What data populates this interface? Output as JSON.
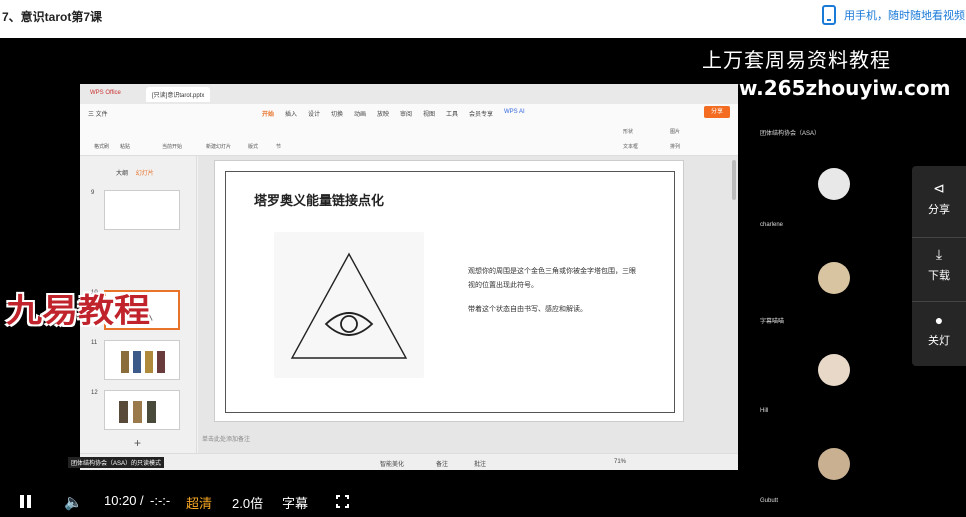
{
  "page": {
    "course_title": "7、意识tarot第7课",
    "phone_link": "用手机，随时随地看视频"
  },
  "watermark": {
    "line1": "上万套周易资料教程",
    "line2": "www.265zhouyiw.com",
    "logo": "九易教程"
  },
  "wps": {
    "tabs": [
      "WPS Office",
      "[只读]意识tarot.pptx"
    ],
    "menu": [
      "三 文件",
      "开始",
      "插入",
      "设计",
      "切换",
      "动画",
      "放映",
      "审阅",
      "视图",
      "工具",
      "会员专享",
      "WPS AI"
    ],
    "share": "分享",
    "ribbon_items": [
      "格式刷",
      "粘贴",
      "当前开始",
      "新建幻灯片",
      "版式",
      "节",
      "形状",
      "图片",
      "文本框",
      "排列"
    ],
    "panel_tabs": [
      "大纲",
      "幻灯片"
    ],
    "thumb_numbers": [
      "9",
      "10",
      "11",
      "12"
    ],
    "note_placeholder": "单击此处添加备注",
    "status_left": "团体结构协会（ASA）的只读模式",
    "status_items": [
      "智能美化",
      "备注",
      "批注",
      "71%"
    ]
  },
  "slide": {
    "title": "塔罗奥义能量链接点化",
    "text1": "观想你的周围是这个金色三角或你被金字塔包围，三眼视的位置出现此符号。",
    "text2": "带着这个状态自由书写、感应和解读。"
  },
  "participants": {
    "names": [
      "团体结构协会（ASA）",
      "charlene",
      "字幕喵喵",
      "Hill",
      "Gubutt"
    ]
  },
  "side_panel": {
    "share": "分享",
    "download": "下载",
    "light": "关灯"
  },
  "controls": {
    "time_current": "10:20",
    "time_separator": "/",
    "time_total": "-:-:-",
    "quality": "超清",
    "speed": "2.0倍",
    "subtitles": "字幕"
  },
  "colors": {
    "accent": "#1a7ad8",
    "wps_orange": "#f36c21",
    "quality": "#f5a623"
  }
}
